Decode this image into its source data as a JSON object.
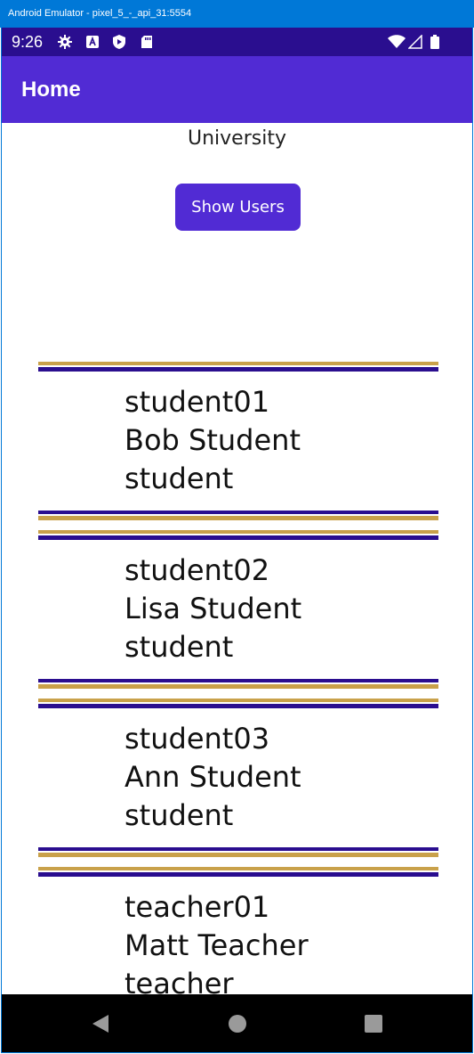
{
  "window": {
    "title": "Android Emulator - pixel_5_-_api_31:5554"
  },
  "statusbar": {
    "time": "9:26",
    "left_icons": [
      "gear-icon",
      "a-icon",
      "play-shield-icon",
      "sd-card-icon"
    ],
    "right_icons": [
      "wifi-icon",
      "signal-icon",
      "battery-icon"
    ]
  },
  "appbar": {
    "title": "Home"
  },
  "main": {
    "university_label": "University",
    "show_users_label": "Show Users",
    "users": [
      {
        "username": "student01",
        "full_name": "Bob Student",
        "role": "student"
      },
      {
        "username": "student02",
        "full_name": "Lisa Student",
        "role": "student"
      },
      {
        "username": "student03",
        "full_name": "Ann Student",
        "role": "student"
      },
      {
        "username": "teacher01",
        "full_name": "Matt Teacher",
        "role": "teacher"
      }
    ]
  },
  "navbar": {
    "buttons": [
      "back-icon",
      "home-icon",
      "recents-icon"
    ]
  },
  "colors": {
    "titlebar": "#0078d7",
    "statusbar": "#2a0e8f",
    "appbar": "#512bd4",
    "button": "#512bd4",
    "stripe_gold": "#c9a14a",
    "stripe_purple": "#2a0e8f"
  }
}
